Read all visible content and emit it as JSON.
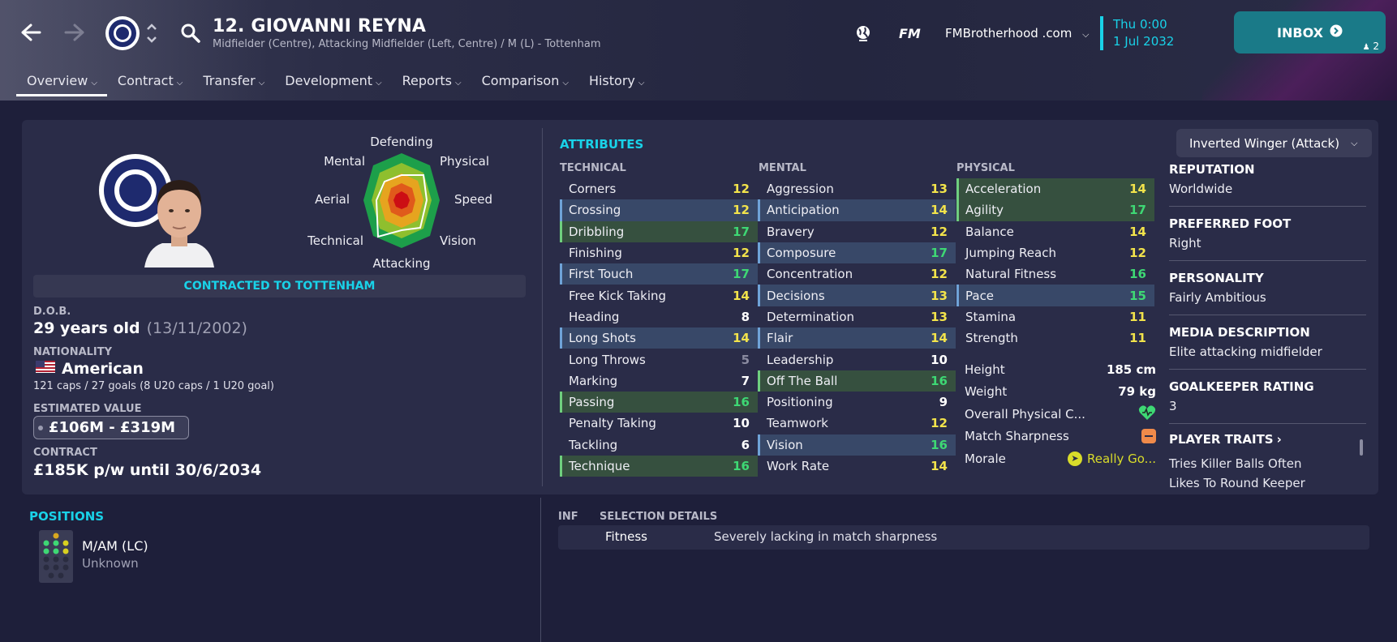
{
  "header": {
    "player_name": "12. GIOVANNI REYNA",
    "player_subtitle": "Midfielder (Centre), Attacking Midfielder (Left, Centre) / M (L) - Tottenham",
    "fm_logo": "FM",
    "site": "FMBrotherhood .com",
    "date_line1": "Thu 0:00",
    "date_line2": "1 Jul 2032",
    "inbox_label": "INBOX",
    "inbox_count": "2"
  },
  "tabs": [
    {
      "label": "Overview"
    },
    {
      "label": "Contract"
    },
    {
      "label": "Transfer"
    },
    {
      "label": "Development"
    },
    {
      "label": "Reports"
    },
    {
      "label": "Comparison"
    },
    {
      "label": "History"
    }
  ],
  "profile": {
    "contract_banner": "CONTRACTED TO TOTTENHAM",
    "dob_label": "D.O.B.",
    "age": "29 years old",
    "dob": "(13/11/2002)",
    "nationality_label": "NATIONALITY",
    "nationality": "American",
    "caps": "121 caps / 27 goals (8 U20 caps / 1 U20 goal)",
    "value_label": "ESTIMATED VALUE",
    "value": "£106M - £319M",
    "contract_label": "CONTRACT",
    "contract": "£185K p/w until 30/6/2034"
  },
  "radar": {
    "labels": [
      "Defending",
      "Physical",
      "Speed",
      "Vision",
      "Attacking",
      "Technical",
      "Aerial",
      "Mental"
    ]
  },
  "attributes": {
    "title": "ATTRIBUTES",
    "technical_label": "TECHNICAL",
    "mental_label": "MENTAL",
    "physical_label": "PHYSICAL",
    "technical": [
      {
        "name": "Corners",
        "value": "12",
        "hl": "",
        "color": "yellow"
      },
      {
        "name": "Crossing",
        "value": "12",
        "hl": "blue",
        "color": "yellow"
      },
      {
        "name": "Dribbling",
        "value": "17",
        "hl": "green",
        "color": "green"
      },
      {
        "name": "Finishing",
        "value": "12",
        "hl": "",
        "color": "yellow"
      },
      {
        "name": "First Touch",
        "value": "17",
        "hl": "blue",
        "color": "green"
      },
      {
        "name": "Free Kick Taking",
        "value": "14",
        "hl": "",
        "color": "yellow"
      },
      {
        "name": "Heading",
        "value": "8",
        "hl": "",
        "color": "white"
      },
      {
        "name": "Long Shots",
        "value": "14",
        "hl": "blue",
        "color": "yellow"
      },
      {
        "name": "Long Throws",
        "value": "5",
        "hl": "",
        "color": "grey"
      },
      {
        "name": "Marking",
        "value": "7",
        "hl": "",
        "color": "white"
      },
      {
        "name": "Passing",
        "value": "16",
        "hl": "green",
        "color": "green"
      },
      {
        "name": "Penalty Taking",
        "value": "10",
        "hl": "",
        "color": "white"
      },
      {
        "name": "Tackling",
        "value": "6",
        "hl": "",
        "color": "white"
      },
      {
        "name": "Technique",
        "value": "16",
        "hl": "green",
        "color": "green"
      }
    ],
    "mental": [
      {
        "name": "Aggression",
        "value": "13",
        "hl": "",
        "color": "yellow"
      },
      {
        "name": "Anticipation",
        "value": "14",
        "hl": "blue",
        "color": "yellow"
      },
      {
        "name": "Bravery",
        "value": "12",
        "hl": "",
        "color": "yellow"
      },
      {
        "name": "Composure",
        "value": "17",
        "hl": "blue",
        "color": "green"
      },
      {
        "name": "Concentration",
        "value": "12",
        "hl": "",
        "color": "yellow"
      },
      {
        "name": "Decisions",
        "value": "13",
        "hl": "blue",
        "color": "yellow"
      },
      {
        "name": "Determination",
        "value": "13",
        "hl": "",
        "color": "yellow"
      },
      {
        "name": "Flair",
        "value": "14",
        "hl": "blue",
        "color": "yellow"
      },
      {
        "name": "Leadership",
        "value": "10",
        "hl": "",
        "color": "white"
      },
      {
        "name": "Off The Ball",
        "value": "16",
        "hl": "green",
        "color": "green"
      },
      {
        "name": "Positioning",
        "value": "9",
        "hl": "",
        "color": "white"
      },
      {
        "name": "Teamwork",
        "value": "12",
        "hl": "",
        "color": "yellow"
      },
      {
        "name": "Vision",
        "value": "16",
        "hl": "blue",
        "color": "green"
      },
      {
        "name": "Work Rate",
        "value": "14",
        "hl": "",
        "color": "yellow"
      }
    ],
    "physical": [
      {
        "name": "Acceleration",
        "value": "14",
        "hl": "green",
        "color": "yellow"
      },
      {
        "name": "Agility",
        "value": "17",
        "hl": "green",
        "color": "green"
      },
      {
        "name": "Balance",
        "value": "14",
        "hl": "",
        "color": "yellow"
      },
      {
        "name": "Jumping Reach",
        "value": "12",
        "hl": "",
        "color": "yellow"
      },
      {
        "name": "Natural Fitness",
        "value": "16",
        "hl": "",
        "color": "green"
      },
      {
        "name": "Pace",
        "value": "15",
        "hl": "blue",
        "color": "green"
      },
      {
        "name": "Stamina",
        "value": "11",
        "hl": "",
        "color": "yellow"
      },
      {
        "name": "Strength",
        "value": "11",
        "hl": "",
        "color": "yellow"
      }
    ],
    "physical_info": {
      "height_label": "Height",
      "height": "185 cm",
      "weight_label": "Weight",
      "weight": "79 kg",
      "condition_label": "Overall Physical C...",
      "sharpness_label": "Match Sharpness",
      "morale_label": "Morale",
      "morale": "Really Go..."
    }
  },
  "side": {
    "role": "Inverted Winger (Attack)",
    "reputation_label": "REPUTATION",
    "reputation": "Worldwide",
    "foot_label": "PREFERRED FOOT",
    "foot": "Right",
    "personality_label": "PERSONALITY",
    "personality": "Fairly Ambitious",
    "media_label": "MEDIA DESCRIPTION",
    "media": "Elite attacking midfielder",
    "gk_label": "GOALKEEPER RATING",
    "gk": "3",
    "traits_label": "PLAYER TRAITS",
    "traits": [
      "Tries Killer Balls Often",
      "Likes To Round Keeper"
    ]
  },
  "positions": {
    "title": "POSITIONS",
    "name": "M/AM (LC)",
    "sub": "Unknown"
  },
  "selection": {
    "inf_label": "INF",
    "details_label": "SELECTION DETAILS",
    "row_label": "Fitness",
    "row_text": "Severely lacking in match sharpness"
  },
  "colors": {
    "accent": "#19d2e8",
    "yellow": "#f2e34b",
    "green": "#3ed874"
  }
}
